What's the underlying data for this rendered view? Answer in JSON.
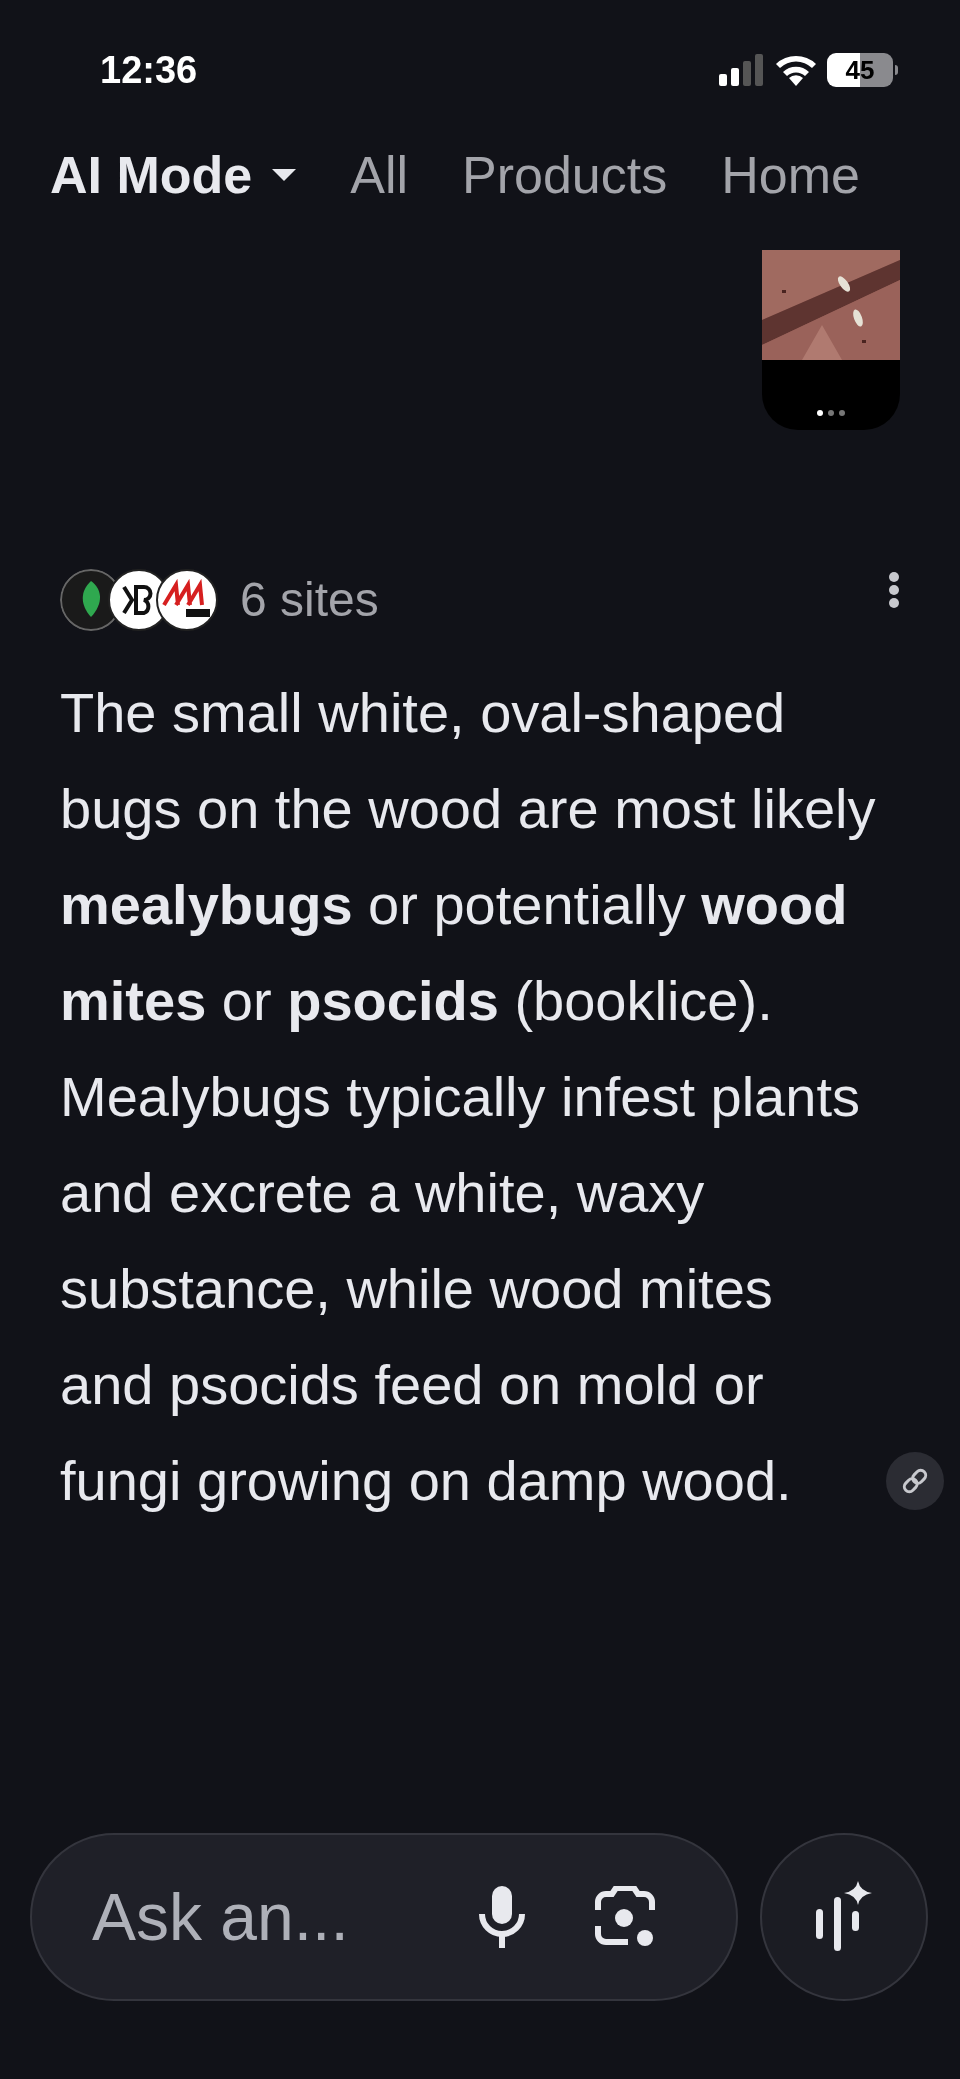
{
  "status_bar": {
    "time": "12:36",
    "battery": "45"
  },
  "tabs": [
    {
      "label": "AI Mode",
      "selected": true,
      "dropdown": true
    },
    {
      "label": "All",
      "selected": false,
      "dropdown": false
    },
    {
      "label": "Products",
      "selected": false,
      "dropdown": false
    },
    {
      "label": "Home",
      "selected": false,
      "dropdown": false
    }
  ],
  "image_carousel": {
    "dots": [
      {
        "selected": true
      },
      {
        "selected": false
      },
      {
        "selected": false
      }
    ]
  },
  "sources": {
    "count": "6 sites"
  },
  "answer": {
    "text": "The small white, oval-shaped bugs on the wood are most likely **mealybugs** or potentially **wood mites** or **psocids** (booklice). Mealybugs typically infest plants and excrete a white, waxy substance, while wood mites and psocids feed on mold or fungi growing on damp wood."
  },
  "ask_bar": {
    "placeholder": "Ask an..."
  }
}
